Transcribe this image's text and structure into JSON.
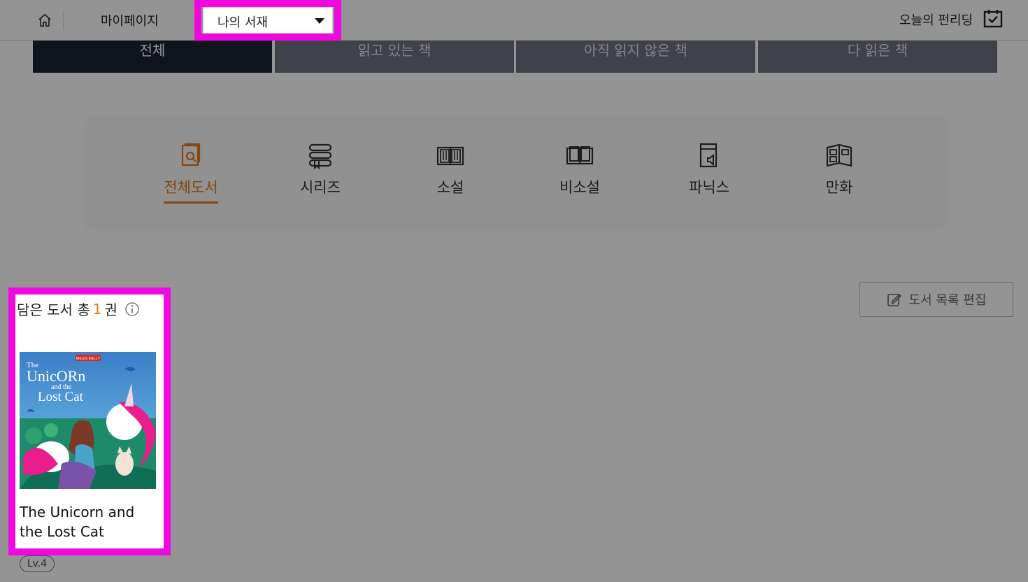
{
  "header": {
    "home_icon": "home-icon",
    "mypage_label": "마이페이지",
    "library_select": {
      "selected": "나의 서재",
      "caret_icon": "caret-down-icon"
    },
    "reading_label": "오늘의 펀리딩",
    "calendar_icon": "calendar-check-icon"
  },
  "status_tabs": [
    "전체",
    "읽고 있는 책",
    "아직 읽지 않은 책",
    "다 읽은 책"
  ],
  "active_status_tab": 0,
  "categories": [
    {
      "label": "전체도서",
      "icon": "book-search-icon",
      "active": true
    },
    {
      "label": "시리즈",
      "icon": "stacked-books-icon",
      "active": false
    },
    {
      "label": "소설",
      "icon": "open-book-icon",
      "active": false
    },
    {
      "label": "비소설",
      "icon": "open-book-outline-icon",
      "active": false
    },
    {
      "label": "파닉스",
      "icon": "book-speaker-icon",
      "active": false
    },
    {
      "label": "만화",
      "icon": "comic-book-icon",
      "active": false
    }
  ],
  "book_list": {
    "count_prefix": "담은 도서 총 ",
    "count": "1",
    "count_suffix": "권",
    "info_icon": "info-icon",
    "edit_label": "도서 목록 편집",
    "edit_icon": "edit-icon",
    "books": [
      {
        "title": "The Unicorn and the Lost Cat",
        "level": "Lv.4",
        "cover_publisher": "MILES KELLY",
        "cover_title_1": "The",
        "cover_title_2": "UnicORn",
        "cover_title_3": "and the",
        "cover_title_4": "Lost Cat"
      }
    ]
  },
  "colors": {
    "accent": "#e07a1f",
    "highlight": "#f008e0",
    "tab_active": "#1c2436",
    "tab_inactive": "#6d7181"
  }
}
